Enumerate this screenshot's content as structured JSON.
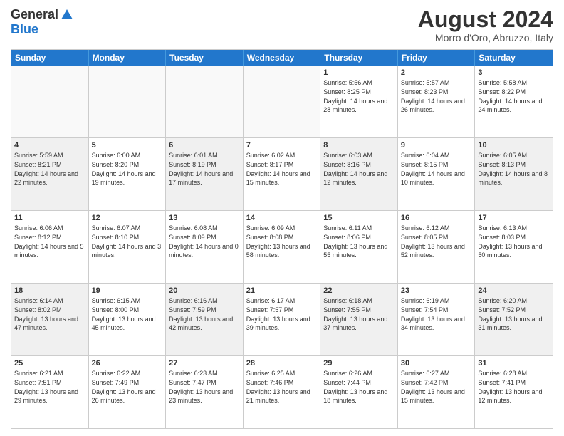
{
  "header": {
    "logo_general": "General",
    "logo_blue": "Blue",
    "month_title": "August 2024",
    "location": "Morro d'Oro, Abruzzo, Italy"
  },
  "days_of_week": [
    "Sunday",
    "Monday",
    "Tuesday",
    "Wednesday",
    "Thursday",
    "Friday",
    "Saturday"
  ],
  "rows": [
    {
      "cells": [
        {
          "day": "",
          "info": "",
          "empty": true
        },
        {
          "day": "",
          "info": "",
          "empty": true
        },
        {
          "day": "",
          "info": "",
          "empty": true
        },
        {
          "day": "",
          "info": "",
          "empty": true
        },
        {
          "day": "1",
          "info": "Sunrise: 5:56 AM\nSunset: 8:25 PM\nDaylight: 14 hours and 28 minutes."
        },
        {
          "day": "2",
          "info": "Sunrise: 5:57 AM\nSunset: 8:23 PM\nDaylight: 14 hours and 26 minutes."
        },
        {
          "day": "3",
          "info": "Sunrise: 5:58 AM\nSunset: 8:22 PM\nDaylight: 14 hours and 24 minutes."
        }
      ]
    },
    {
      "cells": [
        {
          "day": "4",
          "info": "Sunrise: 5:59 AM\nSunset: 8:21 PM\nDaylight: 14 hours and 22 minutes.",
          "shaded": true
        },
        {
          "day": "5",
          "info": "Sunrise: 6:00 AM\nSunset: 8:20 PM\nDaylight: 14 hours and 19 minutes."
        },
        {
          "day": "6",
          "info": "Sunrise: 6:01 AM\nSunset: 8:19 PM\nDaylight: 14 hours and 17 minutes.",
          "shaded": true
        },
        {
          "day": "7",
          "info": "Sunrise: 6:02 AM\nSunset: 8:17 PM\nDaylight: 14 hours and 15 minutes."
        },
        {
          "day": "8",
          "info": "Sunrise: 6:03 AM\nSunset: 8:16 PM\nDaylight: 14 hours and 12 minutes.",
          "shaded": true
        },
        {
          "day": "9",
          "info": "Sunrise: 6:04 AM\nSunset: 8:15 PM\nDaylight: 14 hours and 10 minutes."
        },
        {
          "day": "10",
          "info": "Sunrise: 6:05 AM\nSunset: 8:13 PM\nDaylight: 14 hours and 8 minutes.",
          "shaded": true
        }
      ]
    },
    {
      "cells": [
        {
          "day": "11",
          "info": "Sunrise: 6:06 AM\nSunset: 8:12 PM\nDaylight: 14 hours and 5 minutes."
        },
        {
          "day": "12",
          "info": "Sunrise: 6:07 AM\nSunset: 8:10 PM\nDaylight: 14 hours and 3 minutes."
        },
        {
          "day": "13",
          "info": "Sunrise: 6:08 AM\nSunset: 8:09 PM\nDaylight: 14 hours and 0 minutes."
        },
        {
          "day": "14",
          "info": "Sunrise: 6:09 AM\nSunset: 8:08 PM\nDaylight: 13 hours and 58 minutes."
        },
        {
          "day": "15",
          "info": "Sunrise: 6:11 AM\nSunset: 8:06 PM\nDaylight: 13 hours and 55 minutes."
        },
        {
          "day": "16",
          "info": "Sunrise: 6:12 AM\nSunset: 8:05 PM\nDaylight: 13 hours and 52 minutes."
        },
        {
          "day": "17",
          "info": "Sunrise: 6:13 AM\nSunset: 8:03 PM\nDaylight: 13 hours and 50 minutes."
        }
      ]
    },
    {
      "cells": [
        {
          "day": "18",
          "info": "Sunrise: 6:14 AM\nSunset: 8:02 PM\nDaylight: 13 hours and 47 minutes.",
          "shaded": true
        },
        {
          "day": "19",
          "info": "Sunrise: 6:15 AM\nSunset: 8:00 PM\nDaylight: 13 hours and 45 minutes."
        },
        {
          "day": "20",
          "info": "Sunrise: 6:16 AM\nSunset: 7:59 PM\nDaylight: 13 hours and 42 minutes.",
          "shaded": true
        },
        {
          "day": "21",
          "info": "Sunrise: 6:17 AM\nSunset: 7:57 PM\nDaylight: 13 hours and 39 minutes."
        },
        {
          "day": "22",
          "info": "Sunrise: 6:18 AM\nSunset: 7:55 PM\nDaylight: 13 hours and 37 minutes.",
          "shaded": true
        },
        {
          "day": "23",
          "info": "Sunrise: 6:19 AM\nSunset: 7:54 PM\nDaylight: 13 hours and 34 minutes."
        },
        {
          "day": "24",
          "info": "Sunrise: 6:20 AM\nSunset: 7:52 PM\nDaylight: 13 hours and 31 minutes.",
          "shaded": true
        }
      ]
    },
    {
      "cells": [
        {
          "day": "25",
          "info": "Sunrise: 6:21 AM\nSunset: 7:51 PM\nDaylight: 13 hours and 29 minutes."
        },
        {
          "day": "26",
          "info": "Sunrise: 6:22 AM\nSunset: 7:49 PM\nDaylight: 13 hours and 26 minutes."
        },
        {
          "day": "27",
          "info": "Sunrise: 6:23 AM\nSunset: 7:47 PM\nDaylight: 13 hours and 23 minutes."
        },
        {
          "day": "28",
          "info": "Sunrise: 6:25 AM\nSunset: 7:46 PM\nDaylight: 13 hours and 21 minutes."
        },
        {
          "day": "29",
          "info": "Sunrise: 6:26 AM\nSunset: 7:44 PM\nDaylight: 13 hours and 18 minutes."
        },
        {
          "day": "30",
          "info": "Sunrise: 6:27 AM\nSunset: 7:42 PM\nDaylight: 13 hours and 15 minutes."
        },
        {
          "day": "31",
          "info": "Sunrise: 6:28 AM\nSunset: 7:41 PM\nDaylight: 13 hours and 12 minutes."
        }
      ]
    }
  ]
}
